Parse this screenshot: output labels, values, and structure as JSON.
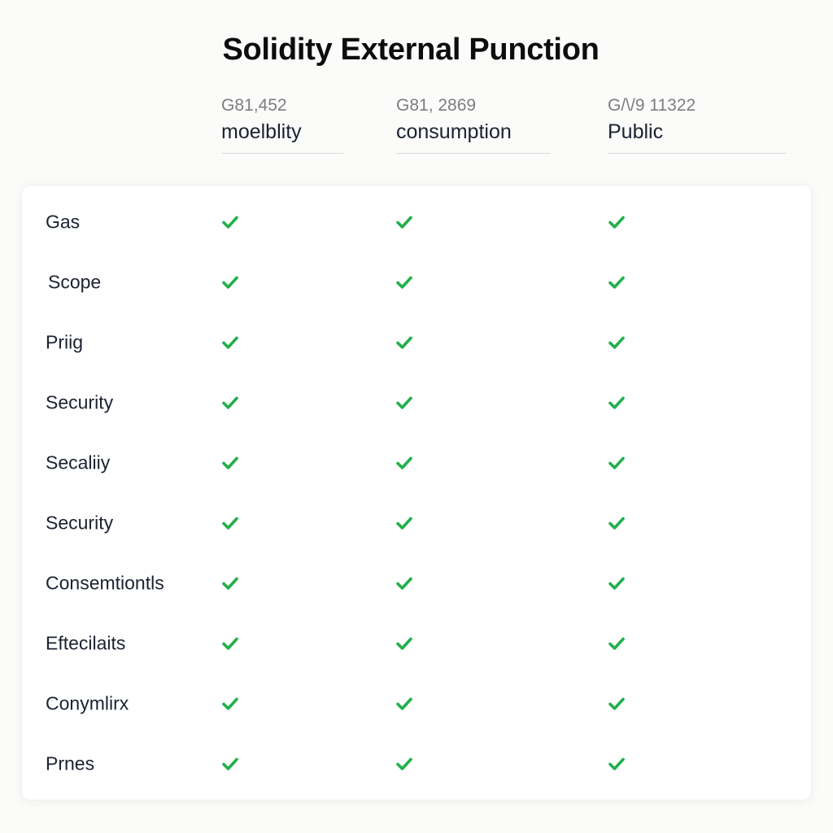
{
  "title": "Solidity External Punction",
  "columns": [
    {
      "code": "G81,452",
      "label": "moelblity"
    },
    {
      "code": "G81, 2869",
      "label": "consumption"
    },
    {
      "code": "G/\\/9 11322",
      "label": "Public"
    }
  ],
  "check_icon": "checkmark-icon",
  "check_color": "#22b04b",
  "rows": [
    {
      "label": "Gas",
      "values": [
        true,
        true,
        true
      ]
    },
    {
      "label": "Scope",
      "values": [
        true,
        true,
        true
      ]
    },
    {
      "label": "Priig",
      "values": [
        true,
        true,
        true
      ]
    },
    {
      "label": "Security",
      "values": [
        true,
        true,
        true
      ]
    },
    {
      "label": "Secaliiy",
      "values": [
        true,
        true,
        true
      ]
    },
    {
      "label": "Security",
      "values": [
        true,
        true,
        true
      ]
    },
    {
      "label": "Consemtiontls",
      "values": [
        true,
        true,
        true
      ]
    },
    {
      "label": "Eftecilaits",
      "values": [
        true,
        true,
        true
      ]
    },
    {
      "label": "Conymlirx",
      "values": [
        true,
        true,
        true
      ]
    },
    {
      "label": "Prnes",
      "values": [
        true,
        true,
        true
      ]
    }
  ]
}
